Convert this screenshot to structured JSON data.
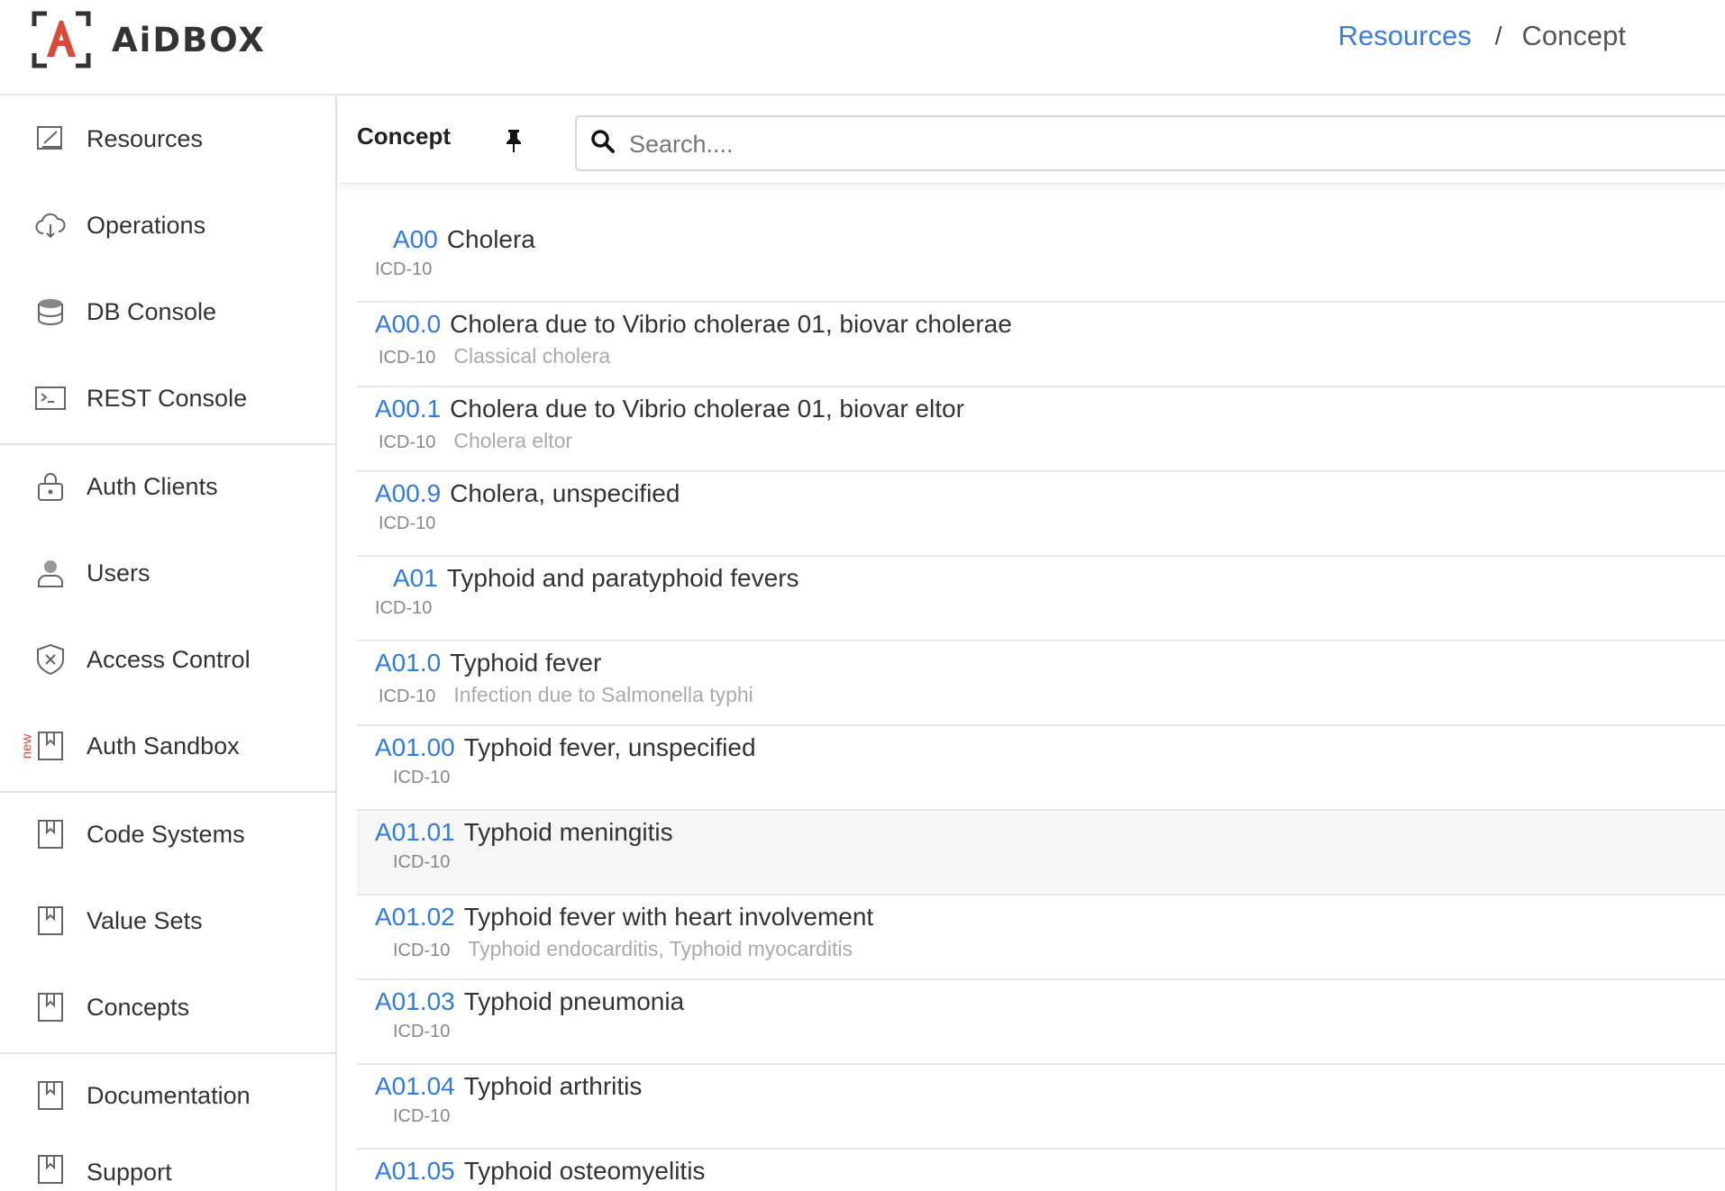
{
  "header": {
    "logo_text": "AiDBOX",
    "breadcrumb": {
      "link": "Resources",
      "separator": "/",
      "current": "Concept"
    }
  },
  "sidebar": {
    "items": [
      {
        "label": "Resources",
        "icon": "resources-icon"
      },
      {
        "label": "Operations",
        "icon": "cloud-icon"
      },
      {
        "label": "DB Console",
        "icon": "database-icon"
      },
      {
        "label": "REST Console",
        "icon": "terminal-icon"
      },
      {
        "label": "Auth Clients",
        "icon": "lock-icon"
      },
      {
        "label": "Users",
        "icon": "user-icon"
      },
      {
        "label": "Access Control",
        "icon": "shield-icon"
      },
      {
        "label": "Auth Sandbox",
        "icon": "bookmark-icon",
        "badge": "new"
      },
      {
        "label": "Code Systems",
        "icon": "bookmark-icon"
      },
      {
        "label": "Value Sets",
        "icon": "bookmark-icon"
      },
      {
        "label": "Concepts",
        "icon": "bookmark-icon"
      },
      {
        "label": "Documentation",
        "icon": "bookmark-icon"
      },
      {
        "label": "Support",
        "icon": "bookmark-icon"
      }
    ]
  },
  "topbar": {
    "title": "Concept",
    "search_placeholder": "Search...."
  },
  "concepts": [
    {
      "code": "A00",
      "display": "Cholera",
      "system": "ICD-10",
      "definition": ""
    },
    {
      "code": "A00.0",
      "display": "Cholera due to Vibrio cholerae 01, biovar cholerae",
      "system": "ICD-10",
      "definition": "Classical cholera"
    },
    {
      "code": "A00.1",
      "display": "Cholera due to Vibrio cholerae 01, biovar eltor",
      "system": "ICD-10",
      "definition": "Cholera eltor"
    },
    {
      "code": "A00.9",
      "display": "Cholera, unspecified",
      "system": "ICD-10",
      "definition": ""
    },
    {
      "code": "A01",
      "display": "Typhoid and paratyphoid fevers",
      "system": "ICD-10",
      "definition": ""
    },
    {
      "code": "A01.0",
      "display": "Typhoid fever",
      "system": "ICD-10",
      "definition": "Infection due to Salmonella typhi"
    },
    {
      "code": "A01.00",
      "display": "Typhoid fever, unspecified",
      "system": "ICD-10",
      "definition": ""
    },
    {
      "code": "A01.01",
      "display": "Typhoid meningitis",
      "system": "ICD-10",
      "definition": ""
    },
    {
      "code": "A01.02",
      "display": "Typhoid fever with heart involvement",
      "system": "ICD-10",
      "definition": "Typhoid endocarditis, Typhoid myocarditis"
    },
    {
      "code": "A01.03",
      "display": "Typhoid pneumonia",
      "system": "ICD-10",
      "definition": ""
    },
    {
      "code": "A01.04",
      "display": "Typhoid arthritis",
      "system": "ICD-10",
      "definition": ""
    },
    {
      "code": "A01.05",
      "display": "Typhoid osteomyelitis",
      "system": "",
      "definition": ""
    }
  ],
  "colors": {
    "accent": "#2f7be0",
    "logo_red": "#d94a38"
  }
}
